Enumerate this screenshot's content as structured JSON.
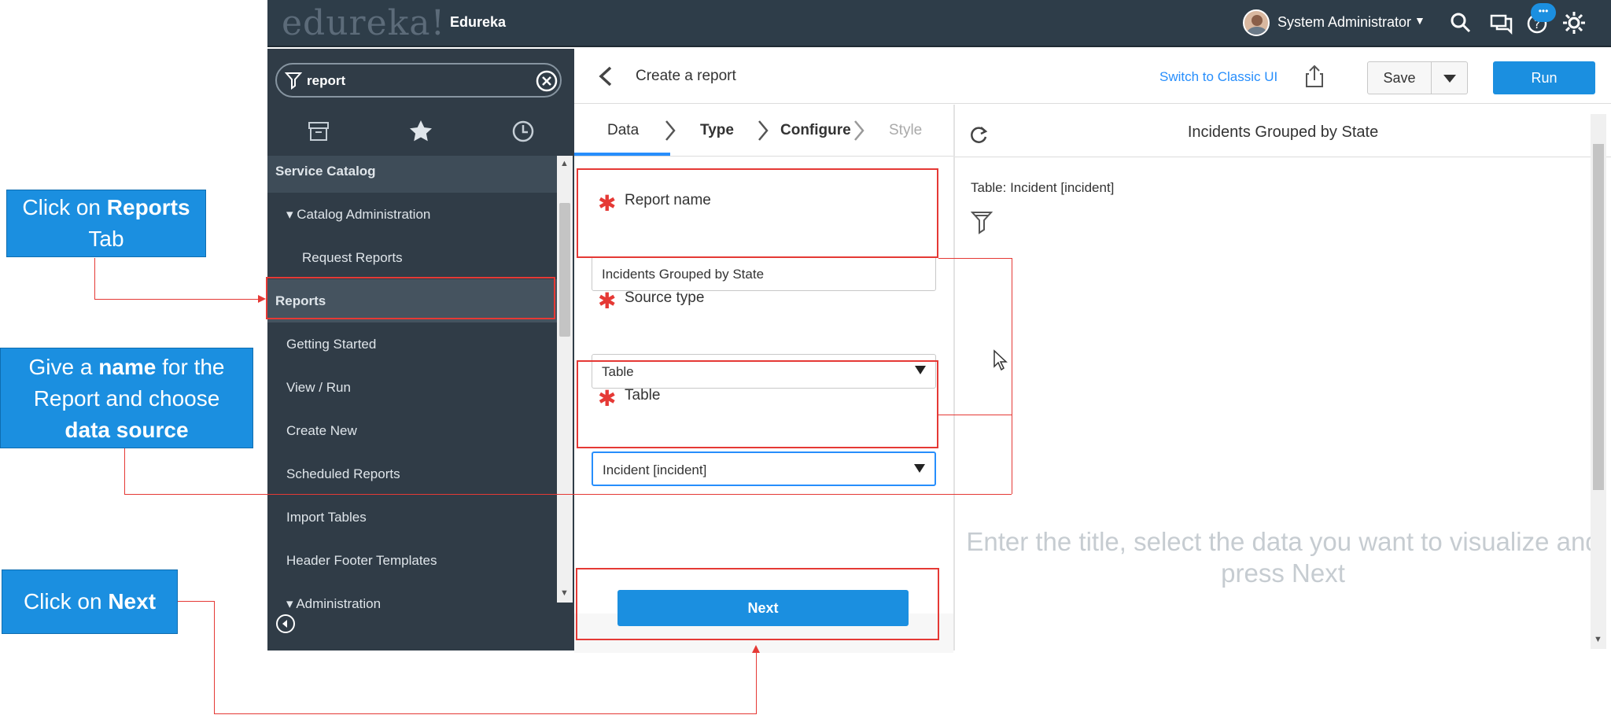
{
  "header": {
    "logo": "edureka!",
    "instance_name": "Edureka",
    "user_name": "System Administrator",
    "notification_badge": "•••",
    "icons": [
      "search-icon",
      "chat-icon",
      "help-icon",
      "gear-icon"
    ]
  },
  "navigator": {
    "search_value": "report",
    "tabs": [
      "archive-icon",
      "star-icon",
      "history-icon"
    ],
    "items": [
      {
        "label": "Service Catalog",
        "type": "section"
      },
      {
        "label": "▾ Catalog Administration",
        "type": "group"
      },
      {
        "label": "Request Reports",
        "type": "item"
      },
      {
        "label": "Reports",
        "type": "section-selected"
      },
      {
        "label": "Getting Started",
        "type": "item"
      },
      {
        "label": "View / Run",
        "type": "item"
      },
      {
        "label": "Create New",
        "type": "item"
      },
      {
        "label": "Scheduled Reports",
        "type": "item"
      },
      {
        "label": "Import Tables",
        "type": "item"
      },
      {
        "label": "Header Footer Templates",
        "type": "item"
      },
      {
        "label": "▾ Administration",
        "type": "group"
      }
    ]
  },
  "toolbar": {
    "page_title": "Create a report",
    "classic_link": "Switch to Classic UI",
    "save_label": "Save",
    "run_label": "Run"
  },
  "steps": [
    {
      "label": "Data",
      "state": "active"
    },
    {
      "label": "Type",
      "state": "enabled"
    },
    {
      "label": "Configure",
      "state": "enabled"
    },
    {
      "label": "Style",
      "state": "disabled"
    }
  ],
  "form": {
    "report_name_label": "Report name",
    "report_name_value": "Incidents Grouped by State",
    "source_type_label": "Source type",
    "source_type_value": "Table",
    "table_label": "Table",
    "table_value": "Incident [incident]",
    "next_label": "Next"
  },
  "preview": {
    "title": "Incidents Grouped by State",
    "table_info": "Table: Incident [incident]",
    "hint": "Enter the title, select the data you want to visualize and press Next"
  },
  "callouts": {
    "reports_tab": {
      "pre": "Click on ",
      "bold": "Reports",
      "post": "Tab"
    },
    "name_source": {
      "pre": "Give a ",
      "bold1": "name",
      "mid": " for the Report and choose",
      "bold2": "data source"
    },
    "next": {
      "pre": "Click on ",
      "bold": "Next"
    }
  },
  "colors": {
    "header_bg": "#2e3d49",
    "nav_bg": "#303c47",
    "accent": "#1b8fe0",
    "annotation_red": "#e53935"
  }
}
